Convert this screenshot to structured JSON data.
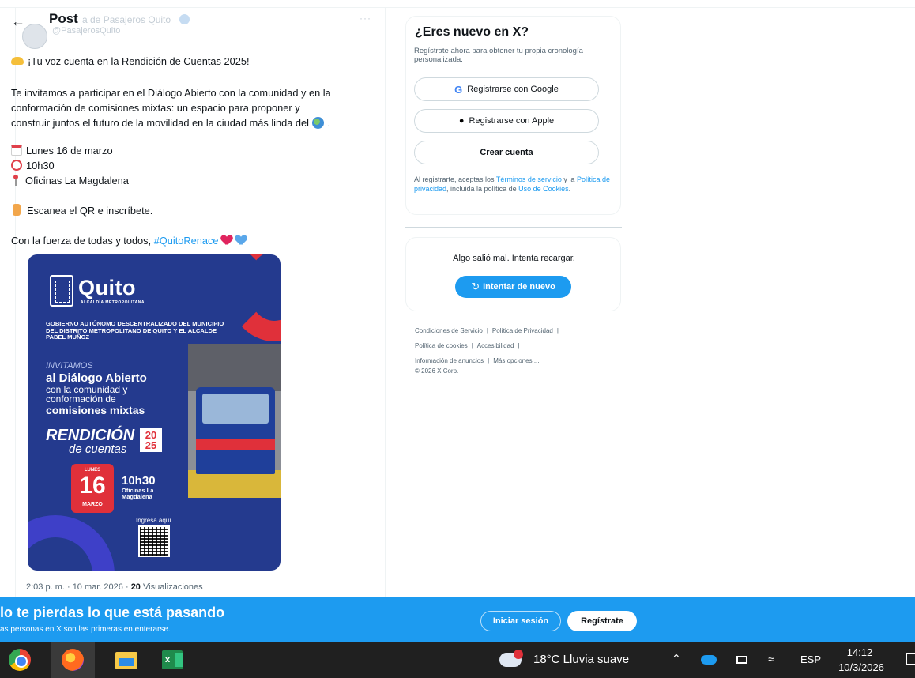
{
  "post": {
    "header_title": "Post",
    "account_name": "Pasajeros Quito",
    "account_name_visible": "a de Pasajeros Quito",
    "account_handle": "@PasajerosQuito",
    "more": "···",
    "lines": [
      "¡Tu voz cuenta en la Rendición de Cuentas 2025!",
      "Te invitamos a participar en el Diálogo Abierto con la comunidad y en la",
      "conformación de comisiones mixtas: un espacio para proponer y",
      "construir juntos el futuro de la movilidad en la ciudad más linda del",
      "Lunes 16 de marzo",
      "10h30",
      "Oficinas La Magdalena",
      "Escanea el QR e inscríbete.",
      "Con la fuerza de todas y todos, ",
      "#QuitoRenace"
    ],
    "meta_time": "2:03 p. m. · 10 mar. 2026 · ",
    "views_count": "20",
    "views_label": " Visualizaciones"
  },
  "poster": {
    "quito": "Quito",
    "alcaldia": "ALCALDÍA METROPOLITANA",
    "gobierno": "GOBIERNO AUTÓNOMO DESCENTRALIZADO DEL MUNICIPIO DEL DISTRITO METROPOLITANO DE QUITO Y EL ALCALDE PABEL MUÑOZ",
    "invitamos": "INVITAMOS",
    "dialogo": "al Diálogo Abierto",
    "con": "con la comunidad y conformación de",
    "comisiones": "comisiones mixtas",
    "rendicion": "RENDICIÓN",
    "year": "20 25",
    "decuentas": "de cuentas",
    "lunes": "LUNES",
    "day": "16",
    "marzo": "MARZO",
    "time": "10h30",
    "place": "Oficinas La Magdalena",
    "ingresa": "Ingresa aquí"
  },
  "signup_card": {
    "title": "¿Eres nuevo en X?",
    "subtitle": "Regístrate ahora para obtener tu propia cronología personalizada.",
    "google_label": "Registrarse con Google",
    "apple_label": "Registrarse con Apple",
    "create_label": "Crear cuenta",
    "legal_pre": "Al registrarte, aceptas los ",
    "terms": "Términos de servicio",
    "legal_mid1": " y la ",
    "privacy": "Política de privacidad",
    "legal_mid2": ", incluida la política de ",
    "cookies": "Uso de Cookies",
    "legal_end": "."
  },
  "error_card": {
    "message": "Algo salió mal. Intenta recargar.",
    "retry_label": "Intentar de nuevo"
  },
  "footer": {
    "terms": "Condiciones de Servicio",
    "privacy": "Política de Privacidad",
    "cookies": "Política de cookies",
    "accessibility": "Accesibilidad",
    "ads": "Información de anuncios",
    "more": "Más opciones ...",
    "copyright": "© 2026 X Corp.",
    "sep": "|"
  },
  "banner": {
    "title": "lo te pierdas lo que está pasando",
    "subtitle": "as personas en X son las primeras en enterarse.",
    "login_label": "Iniciar sesión",
    "register_label": "Regístrate"
  },
  "taskbar": {
    "weather": "18°C  Lluvia suave",
    "lang": "ESP",
    "time": "14:12",
    "date": "10/3/2026",
    "excel_letter": "x"
  },
  "colors": {
    "accent": "#1d9bf0",
    "poster_blue": "#243a8e",
    "poster_red": "#e0303a",
    "taskbar": "#202020"
  }
}
